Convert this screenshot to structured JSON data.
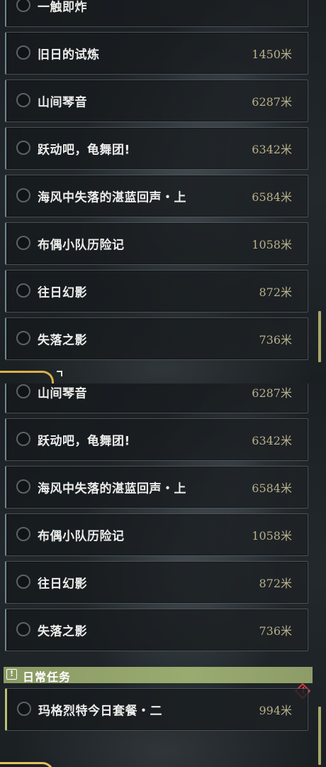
{
  "top_list": {
    "quests": [
      {
        "name": "一触即炸",
        "distance": ""
      },
      {
        "name": "旧日的试炼",
        "distance": "1450米"
      },
      {
        "name": "山间琴音",
        "distance": "6287米"
      },
      {
        "name": "跃动吧，龟舞团!",
        "distance": "6342米"
      },
      {
        "name": "海风中失落的湛蓝回声・上",
        "distance": "6584米"
      },
      {
        "name": "布偶小队历险记",
        "distance": "1058米"
      },
      {
        "name": "往日幻影",
        "distance": "872米"
      },
      {
        "name": "失落之影",
        "distance": "736米"
      }
    ]
  },
  "bottom_list": {
    "quests": [
      {
        "name": "山间琴音",
        "distance": "6287米"
      },
      {
        "name": "跃动吧，龟舞团!",
        "distance": "6342米"
      },
      {
        "name": "海风中失落的湛蓝回声・上",
        "distance": "6584米"
      },
      {
        "name": "布偶小队历险记",
        "distance": "1058米"
      },
      {
        "name": "往日幻影",
        "distance": "872米"
      },
      {
        "name": "失落之影",
        "distance": "736米"
      }
    ],
    "daily_section": {
      "badge": "!",
      "title": "日常任务",
      "quests": [
        {
          "name": "玛格烈特今日套餐・二",
          "distance": "994米"
        }
      ]
    },
    "alert_icon": "!"
  },
  "colors": {
    "accent_gold": "#d8b04a",
    "distance_text": "#b9b08c",
    "daily_header": "#9aab70",
    "alert_red": "#c0404e"
  }
}
